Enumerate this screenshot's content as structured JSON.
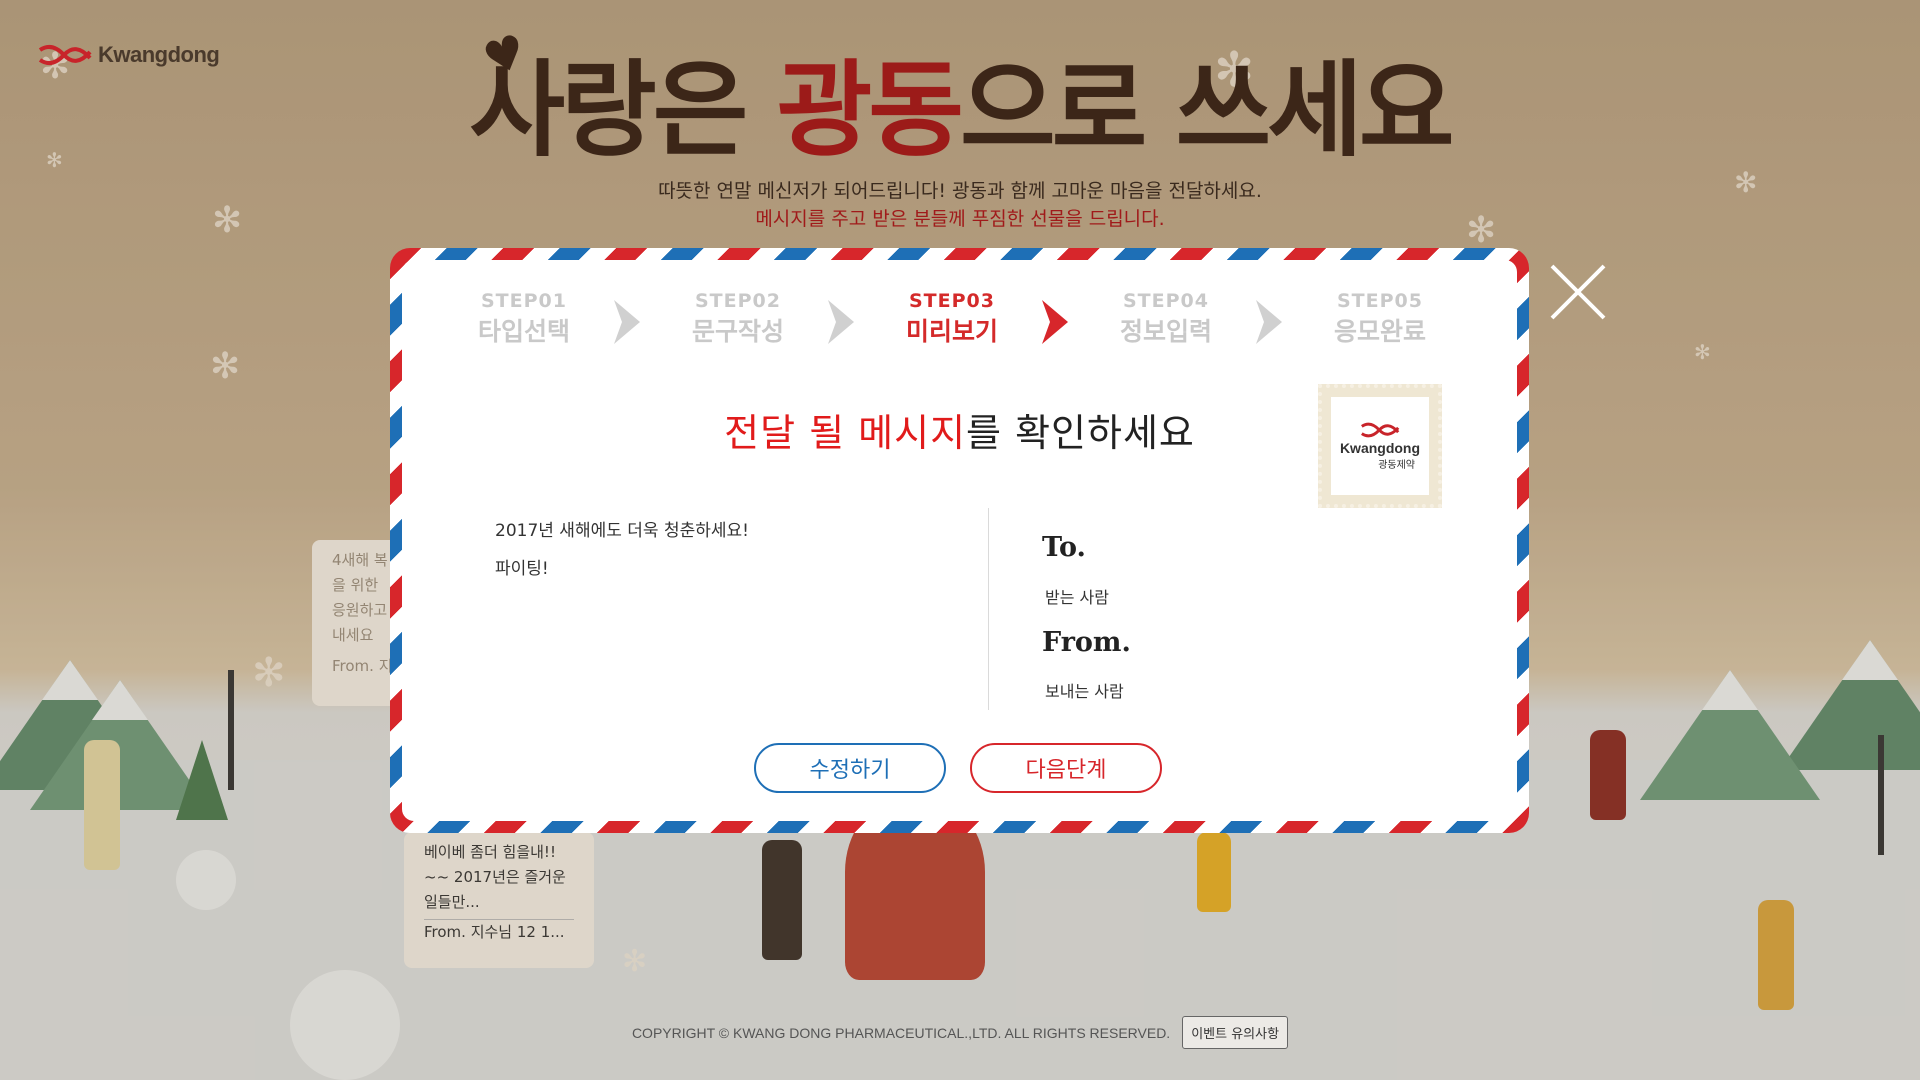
{
  "brand": {
    "logo_text": "Kwangdong"
  },
  "hero": {
    "headline_pre": "사랑은 ",
    "headline_red": "광동",
    "headline_post": "으로 쓰세요",
    "subtitle_1": "따뜻한 연말 메신저가 되어드립니다! 광동과 함께 고마운 마음을 전달하세요.",
    "subtitle_2": "메시지를 주고 받은 분들께 푸짐한 선물을 드립니다."
  },
  "steps": [
    {
      "num": "STEP01",
      "label": "타입선택",
      "active": false
    },
    {
      "num": "STEP02",
      "label": "문구작성",
      "active": false
    },
    {
      "num": "STEP03",
      "label": "미리보기",
      "active": true
    },
    {
      "num": "STEP04",
      "label": "정보입력",
      "active": false
    },
    {
      "num": "STEP05",
      "label": "응모완료",
      "active": false
    }
  ],
  "modal": {
    "title_red": "전달 될 메시지",
    "title_rest": "를 확인하세요",
    "stamp": {
      "brand_en": "Kwangdong",
      "brand_ko": "광동제약"
    },
    "message_lines": [
      "2017년 새해에도 더욱 청춘하세요!",
      "파이팅!"
    ],
    "to_label": "To.",
    "to_value": "받는 사람",
    "from_label": "From.",
    "from_value": "보내는 사람",
    "edit_button": "수정하기",
    "next_button": "다음단계"
  },
  "background_bubbles": {
    "left_lines": [
      "4새해 복",
      "을 위한",
      "응원하고",
      "내세요",
      "From. 지"
    ],
    "center_lines": [
      "베이베 좀더 힘을내!!",
      "~~ 2017년은 즐거운",
      "일들만...",
      "From. 지수님 12 1..."
    ]
  },
  "footer": {
    "copyright": "COPYRIGHT © KWANG DONG PHARMACEUTICAL.,LTD. ALL RIGHTS RESERVED.",
    "notice_button": "이벤트 유의사항"
  },
  "colors": {
    "accent_red": "#d7262b",
    "accent_blue": "#1e6fb6",
    "inactive_step": "#c9c9c9"
  },
  "icons": [
    "kwangdong-logo-icon",
    "close-icon",
    "chevron-right-icon",
    "heart-icon",
    "snowflake-icon"
  ]
}
